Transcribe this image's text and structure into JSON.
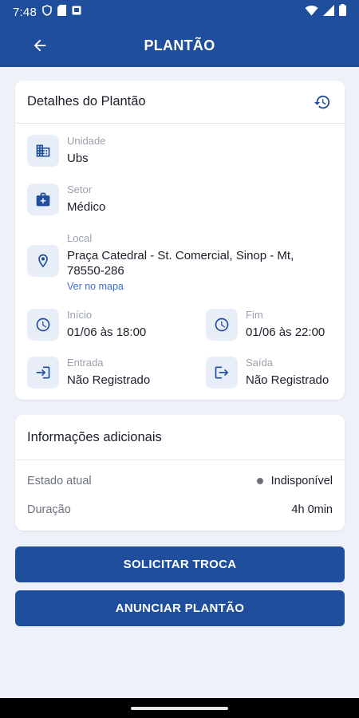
{
  "status_bar": {
    "time": "7:48"
  },
  "app_bar": {
    "title": "PLANTÃO"
  },
  "details": {
    "title": "Detalhes do Plantão",
    "unit_label": "Unidade",
    "unit_value": "Ubs",
    "sector_label": "Setor",
    "sector_value": "Médico",
    "location_label": "Local",
    "location_line1": "Praça Catedral - St. Comercial, Sinop - Mt,",
    "location_line2": "78550-286",
    "map_link": "Ver no mapa",
    "start_label": "Início",
    "start_value": "01/06 às 18:00",
    "end_label": "Fim",
    "end_value": "01/06 às 22:00",
    "entry_label": "Entrada",
    "entry_value": "Não Registrado",
    "exit_label": "Saída",
    "exit_value": "Não Registrado"
  },
  "additional": {
    "title": "Informações adicionais",
    "state_label": "Estado atual",
    "state_value": "Indisponível",
    "duration_label": "Duração",
    "duration_value": "4h 0min"
  },
  "actions": {
    "request_swap": "SOLICITAR TROCA",
    "announce_shift": "ANUNCIAR PLANTÃO"
  },
  "colors": {
    "primary": "#1f4e9c",
    "icon_bg": "#e8eef8",
    "link": "#3b6fd1",
    "status_dot": "#6b6f78"
  },
  "icons": [
    "arrow-left-icon",
    "history-icon",
    "building-icon",
    "medical-bag-icon",
    "location-pin-icon",
    "clock-icon",
    "login-icon",
    "logout-icon"
  ]
}
